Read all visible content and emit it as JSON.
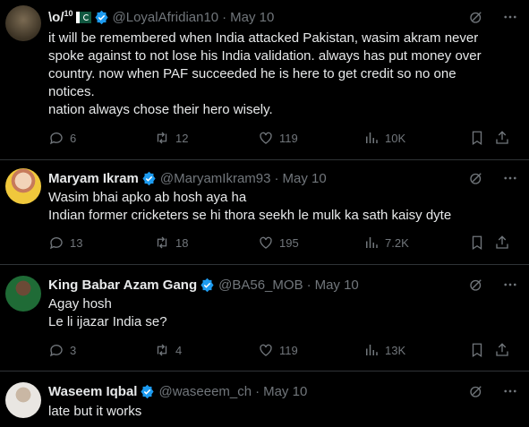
{
  "tweets": [
    {
      "name": "\\o/",
      "name_sup": "10",
      "handle": "@LoyalAfridian10",
      "dot": "·",
      "date": "May 10",
      "body": "it will be remembered when India attacked Pakistan, wasim akram never\nspoke against to not lose his India validation. always has put money over\ncountry. now when PAF succeeded he is here to get credit so no one\nnotices.\nnation always chose their hero wisely.",
      "replies": "6",
      "reposts": "12",
      "likes": "119",
      "views": "10K"
    },
    {
      "name": "Maryam Ikram",
      "handle": "@MaryamIkram93",
      "dot": "·",
      "date": "May 10",
      "body": "Wasim bhai apko ab hosh aya ha\nIndian former cricketers se hi thora seekh le mulk ka sath kaisy dyte",
      "replies": "13",
      "reposts": "18",
      "likes": "195",
      "views": "7.2K"
    },
    {
      "name": "King Babar Azam Gang",
      "handle": "@BA56_MOB",
      "dot": "·",
      "date": "May 10",
      "body": "Agay hosh\nLe li ijazar India se?",
      "replies": "3",
      "reposts": "4",
      "likes": "119",
      "views": "13K"
    },
    {
      "name": "Waseem Iqbal",
      "handle": "@waseeem_ch",
      "dot": "·",
      "date": "May 10",
      "body": "late but it works"
    }
  ],
  "icons": [
    "grok-icon",
    "more-icon",
    "reply-icon",
    "repost-icon",
    "like-icon",
    "views-icon",
    "bookmark-icon",
    "share-icon",
    "verified-badge-icon",
    "pakistan-flag-icon"
  ],
  "colors": {
    "background": "#000000",
    "text": "#e7e9ea",
    "muted": "#71767b",
    "verified": "#1d9bf0",
    "divider": "#2f3336"
  }
}
